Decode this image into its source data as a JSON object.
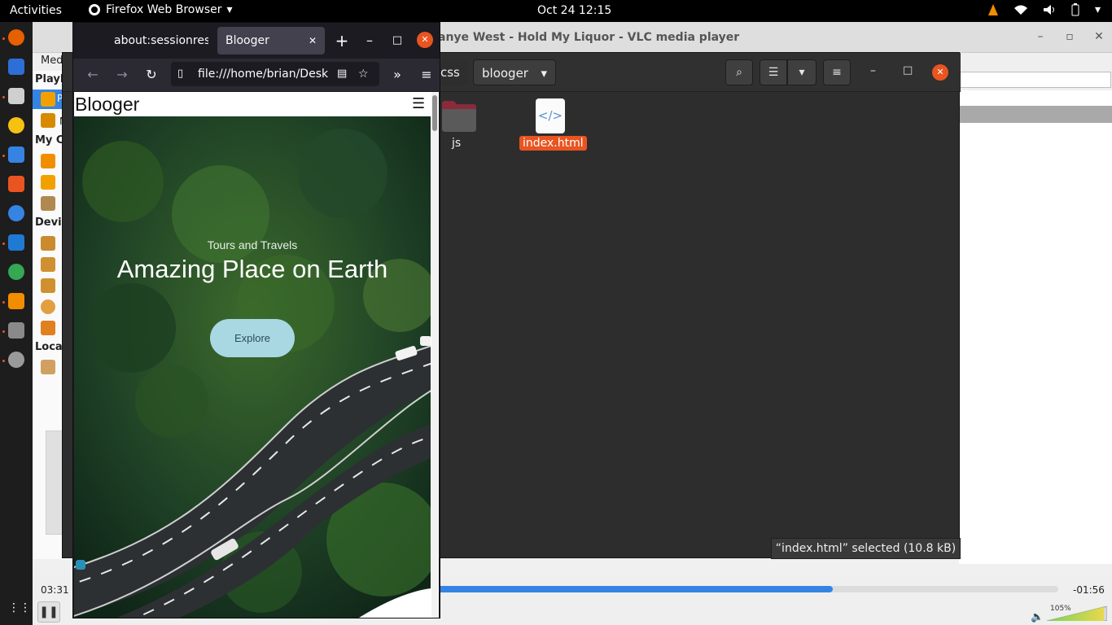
{
  "topbar": {
    "activities": "Activities",
    "app_name": "Firefox Web Browser",
    "clock": "Oct 24  12:15"
  },
  "vlc": {
    "title": "anye West - Hold My Liquor - VLC media player",
    "menu_media": "Medi",
    "sections": {
      "playlist": "Playl",
      "my_computer": "My Co",
      "devices": "Devic",
      "local": "Local"
    },
    "side_letters": {
      "p": "P",
      "m": "M"
    },
    "time_elapsed": "03:31",
    "time_remaining": "-01:56",
    "volume_label": "105%",
    "progress_fraction": 0.64
  },
  "files": {
    "breadcrumbs": [
      "css",
      "blooger"
    ],
    "items": [
      {
        "name": "js",
        "type": "folder"
      },
      {
        "name": "index.html",
        "type": "html",
        "selected": true
      }
    ],
    "status": "“index.html” selected  (10.8 kB)"
  },
  "firefox": {
    "tabs": [
      {
        "label": "about:sessionrest",
        "active": false
      },
      {
        "label": "Blooger",
        "active": true
      }
    ],
    "url": "file:///home/brian/Desk",
    "site": {
      "brand": "Blooger",
      "subtitle": "Tours and Travels",
      "headline": "Amazing Place on Earth",
      "cta": "Explore"
    }
  },
  "colors": {
    "accent": "#e95420",
    "vlc_progress": "#3584e4",
    "explore_button": "#a9d8e3"
  }
}
